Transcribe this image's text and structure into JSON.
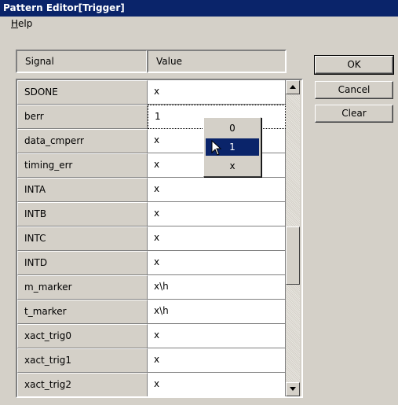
{
  "window": {
    "title": "Pattern Editor[Trigger]"
  },
  "menu": {
    "help_label": "Help",
    "help_mnemonic": "H",
    "help_rest": "elp"
  },
  "table": {
    "headers": {
      "signal": "Signal",
      "value": "Value"
    },
    "rows": [
      {
        "signal": "SDONE",
        "value": "x"
      },
      {
        "signal": "berr",
        "value": "1"
      },
      {
        "signal": "data_cmperr",
        "value": "x"
      },
      {
        "signal": "timing_err",
        "value": "x"
      },
      {
        "signal": "INTA",
        "value": "x"
      },
      {
        "signal": "INTB",
        "value": "x"
      },
      {
        "signal": "INTC",
        "value": "x"
      },
      {
        "signal": "INTD",
        "value": "x"
      },
      {
        "signal": "m_marker",
        "value": "x\\h"
      },
      {
        "signal": "t_marker",
        "value": "x\\h"
      },
      {
        "signal": "xact_trig0",
        "value": "x"
      },
      {
        "signal": "xact_trig1",
        "value": "x"
      },
      {
        "signal": "xact_trig2",
        "value": "x"
      }
    ],
    "active_row": 1
  },
  "buttons": {
    "ok": "OK",
    "cancel": "Cancel",
    "clear": "Clear"
  },
  "dropdown": {
    "options": [
      "0",
      "1",
      "x"
    ],
    "selected_index": 1
  },
  "colors": {
    "title_bar": "#0a246a",
    "face": "#d4d0c8",
    "selection": "#0a246a"
  }
}
